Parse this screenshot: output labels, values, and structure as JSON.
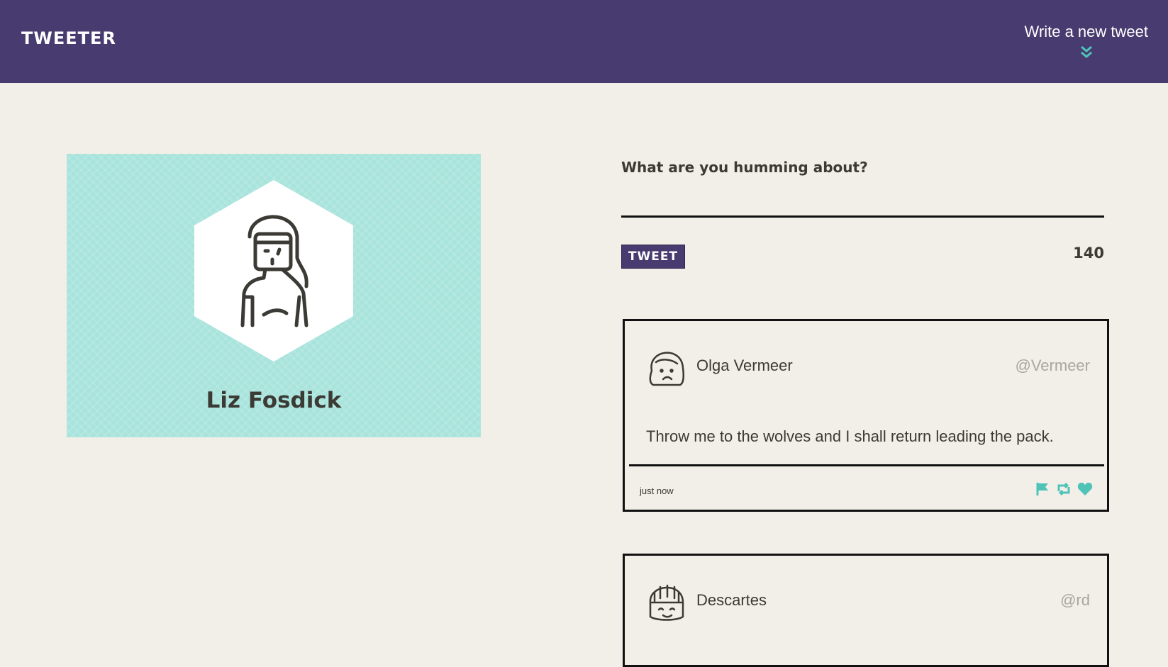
{
  "header": {
    "logo": "TWEETER",
    "compose_toggle_label": "Write a new tweet",
    "compose_toggle_icon": "double-chevron-down-icon"
  },
  "profile": {
    "name": "Liz Fosdick",
    "avatar_icon": "woman-avatar-icon",
    "background_color": "#a8e4dc"
  },
  "composer": {
    "label": "What are you humming about?",
    "input_value": "",
    "button_label": "TWEET",
    "char_counter": "140"
  },
  "tweets": [
    {
      "author": "Olga Vermeer",
      "handle": "@Vermeer",
      "text": "Throw me to the wolves and I shall return leading the pack.",
      "time": "just now",
      "avatar_icon": "woman-avatar-icon",
      "actions": [
        "flag-icon",
        "retweet-icon",
        "heart-icon"
      ]
    },
    {
      "author": "Descartes",
      "handle": "@rd",
      "avatar_icon": "man-avatar-icon"
    }
  ],
  "colors": {
    "nav_background": "#473b70",
    "page_background": "#f2efe8",
    "accent": "#4fc3b8",
    "text": "#3c3a35",
    "muted": "#a9a6a0"
  }
}
